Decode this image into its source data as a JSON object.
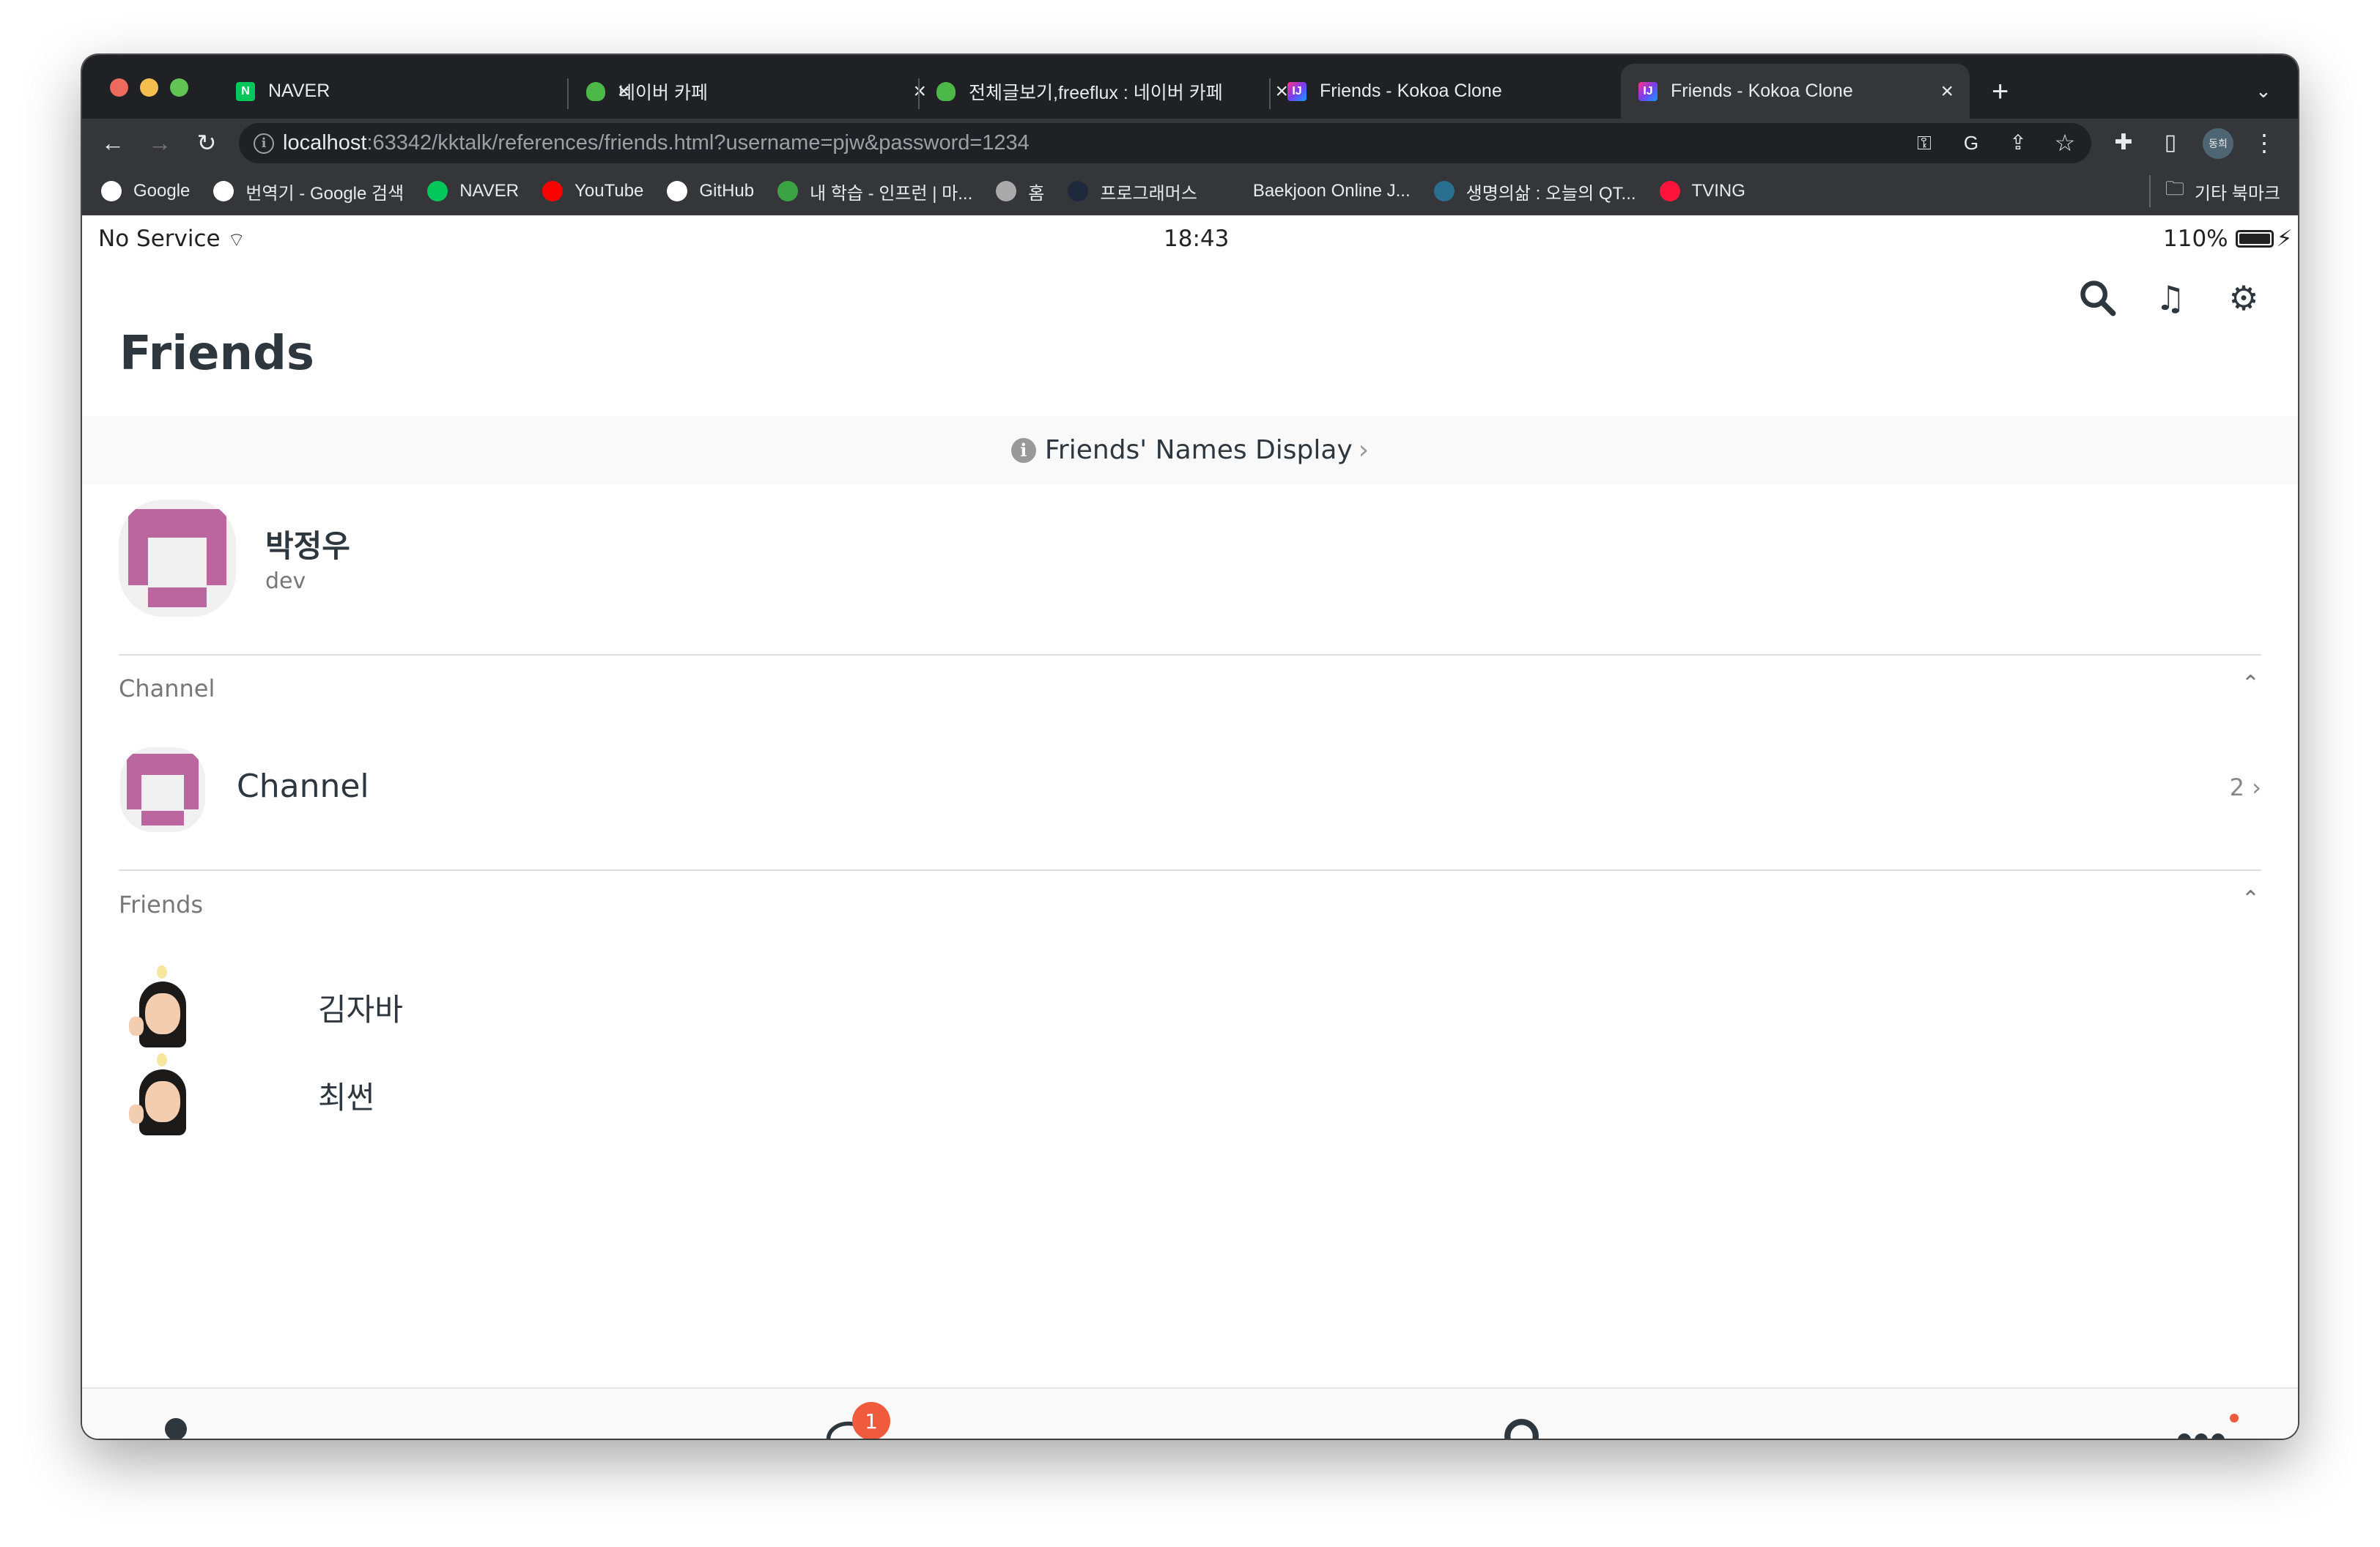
{
  "browser": {
    "tabs": [
      {
        "title": "NAVER",
        "icon": "naver-icon",
        "active": false
      },
      {
        "title": "네이버 카페",
        "icon": "naver-cafe-icon",
        "active": false
      },
      {
        "title": "전체글보기,freeflux : 네이버 카페",
        "icon": "naver-cafe-icon",
        "active": false
      },
      {
        "title": "Friends - Kokoa Clone",
        "icon": "intellij-icon",
        "active": false
      },
      {
        "title": "Friends - Kokoa Clone",
        "icon": "intellij-icon",
        "active": true
      }
    ],
    "url_host": "localhost",
    "url_rest": ":63342/kktalk/references/friends.html?username=pjw&password=1234",
    "profile_initials": "동희",
    "bookmarks": [
      {
        "label": "Google",
        "icon": "google-icon",
        "color": "#ffffff"
      },
      {
        "label": "번역기 - Google 검색",
        "icon": "google-icon",
        "color": "#ffffff"
      },
      {
        "label": "NAVER",
        "icon": "naver-icon",
        "color": "#03c75a"
      },
      {
        "label": "YouTube",
        "icon": "youtube-icon",
        "color": "#ff0000"
      },
      {
        "label": "GitHub",
        "icon": "github-icon",
        "color": "#ffffff"
      },
      {
        "label": "내 학습 - 인프런 | 마...",
        "icon": "inflearn-icon",
        "color": "#3ca344"
      },
      {
        "label": "홈",
        "icon": "globe-icon",
        "color": "#aaaaaa"
      },
      {
        "label": "프로그래머스",
        "icon": "programmers-icon",
        "color": "#1e2a3c"
      },
      {
        "label": "Baekjoon Online J...",
        "icon": "baekjoon-icon",
        "color": "#35363a"
      },
      {
        "label": "생명의삶 : 오늘의 QT...",
        "icon": "qt-icon",
        "color": "#2a6f8f"
      },
      {
        "label": "TVING",
        "icon": "tving-icon",
        "color": "#ff153c"
      }
    ],
    "other_bookmarks": "기타 북마크"
  },
  "status_bar": {
    "carrier": "No Service",
    "time": "18:43",
    "battery": "110%"
  },
  "header": {
    "title": "Friends"
  },
  "banner": {
    "text": "Friends' Names Display",
    "chevron": "›"
  },
  "profile": {
    "name": "박정우",
    "status": "dev"
  },
  "channel_section": {
    "title": "Channel",
    "item_label": "Channel",
    "count": "2"
  },
  "friends_section": {
    "title": "Friends",
    "friends": [
      {
        "name": "김자바"
      },
      {
        "name": "최썬"
      }
    ]
  },
  "nav": {
    "chat_badge": "1",
    "accent": "#f05a3d"
  }
}
